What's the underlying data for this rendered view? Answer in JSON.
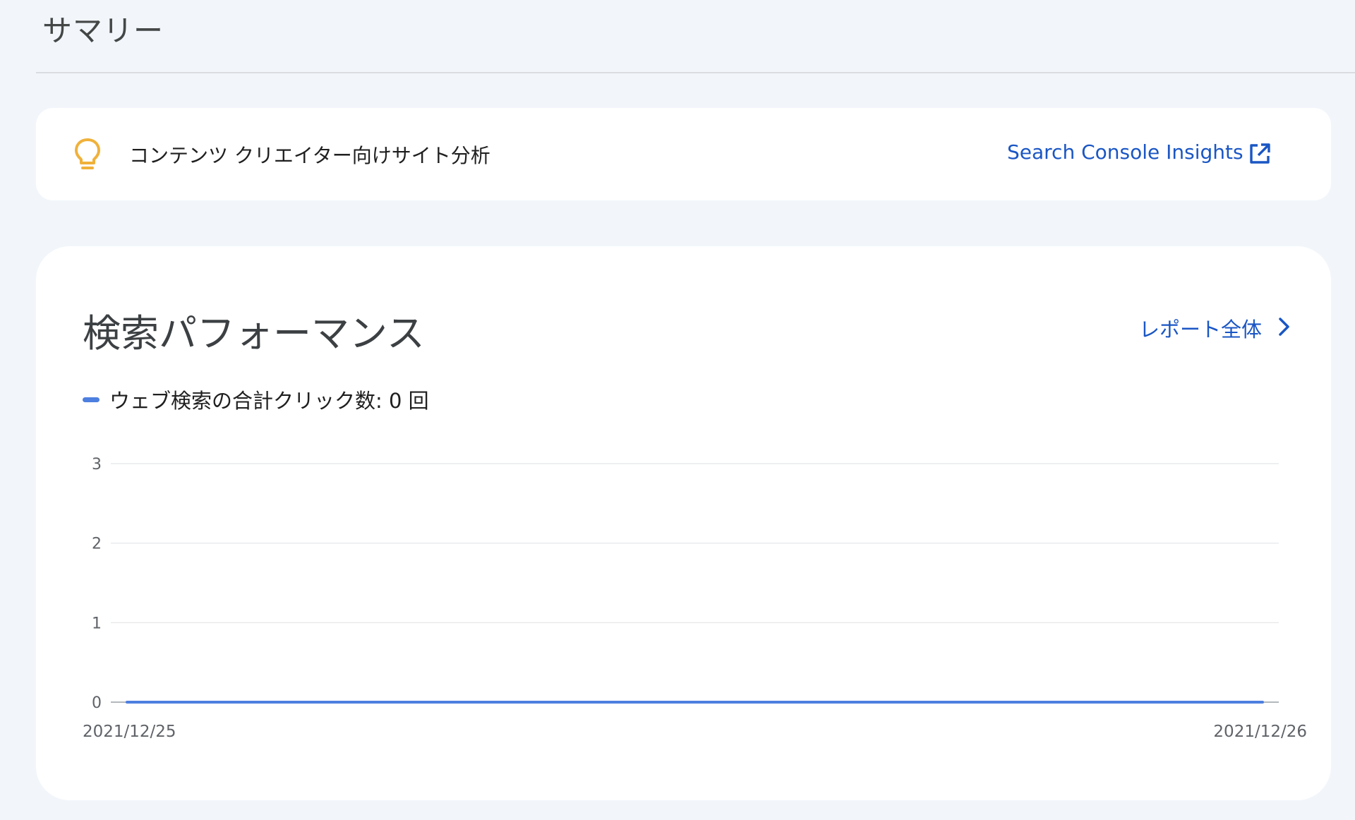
{
  "page": {
    "title": "サマリー"
  },
  "insights": {
    "text": "コンテンツ クリエイター向けサイト分析",
    "link_label": "Search Console Insights",
    "bulb_color": "#f0b13a"
  },
  "performance": {
    "title": "検索パフォーマンス",
    "full_report_label": "レポート全体",
    "legend_label": "ウェブ検索の合計クリック数: 0 回",
    "series_color": "#4d7fe0"
  },
  "chart_data": {
    "type": "line",
    "x": [
      "2021/12/25",
      "2021/12/26"
    ],
    "series": [
      {
        "name": "ウェブ検索の合計クリック数",
        "values": [
          0,
          0
        ]
      }
    ],
    "yticks": [
      "0",
      "1",
      "2",
      "3"
    ],
    "ylim": [
      0,
      3
    ],
    "grid": true
  }
}
